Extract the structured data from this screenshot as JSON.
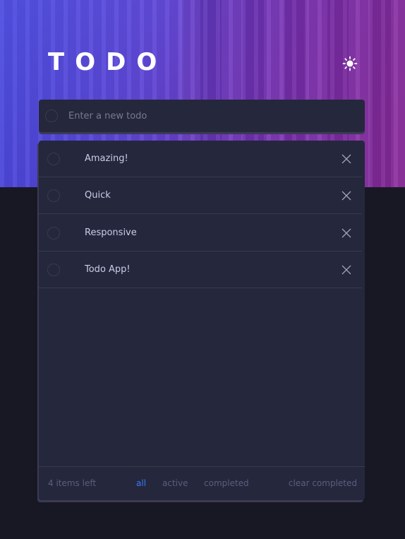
{
  "header": {
    "title": "TODO",
    "theme_icon": "sun-icon"
  },
  "new_todo": {
    "placeholder": "Enter a new todo",
    "value": ""
  },
  "todos": [
    {
      "label": "Amazing!",
      "completed": false
    },
    {
      "label": "Quick",
      "completed": false
    },
    {
      "label": "Responsive",
      "completed": false
    },
    {
      "label": "Todo App!",
      "completed": false
    }
  ],
  "footer": {
    "items_left": "4 items left",
    "filters": {
      "all": "all",
      "active": "active",
      "completed": "completed"
    },
    "selected_filter": "all",
    "clear_label": "clear completed"
  },
  "colors": {
    "page_bg": "#181824",
    "panel_bg": "#25273c",
    "text": "#cacde8",
    "muted": "#5b5e7e",
    "accent": "#3a7bfd",
    "divider": "#393a4c"
  }
}
